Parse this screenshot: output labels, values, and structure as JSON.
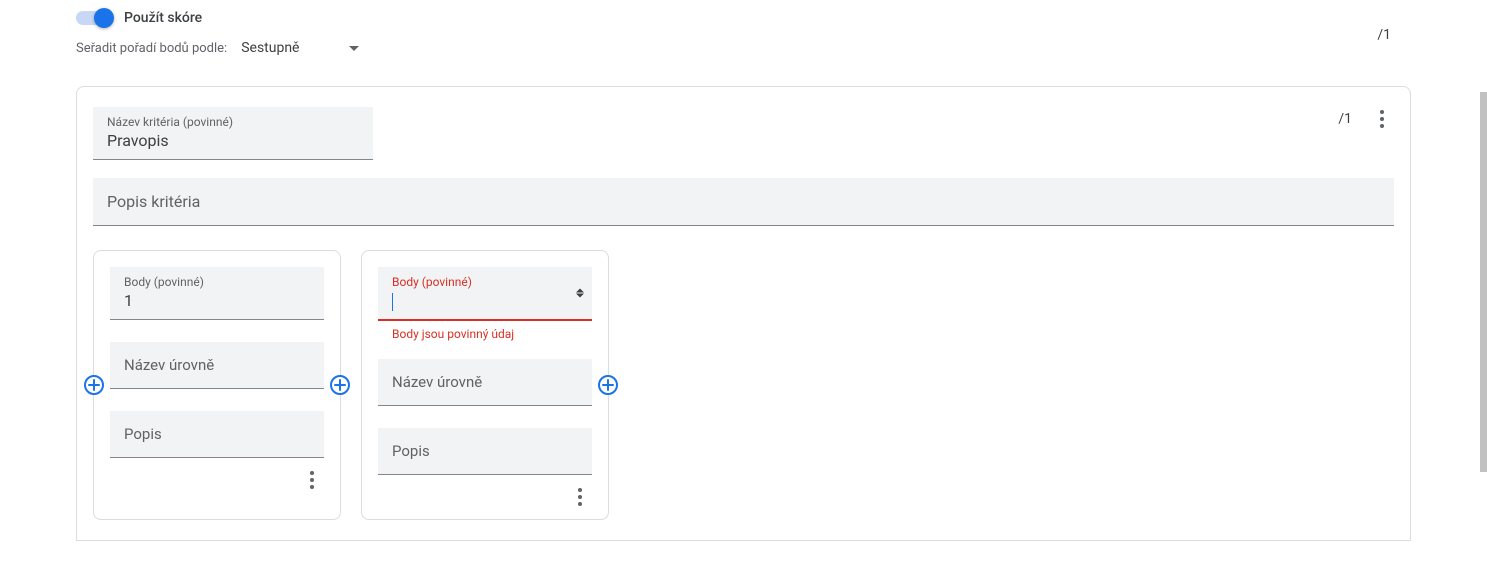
{
  "header": {
    "toggle_label": "Použít skóre",
    "sort_label": "Seřadit pořadí bodů podle:",
    "sort_value": "Sestupně",
    "total_score": "/1"
  },
  "criterion": {
    "title_label": "Název kritéria (povinné)",
    "title_value": "Pravopis",
    "desc_placeholder": "Popis kritéria",
    "score": "/1",
    "levels": [
      {
        "points_label": "Body (povinné)",
        "points_value": "1",
        "name_placeholder": "Název úrovně",
        "desc_placeholder": "Popis",
        "error": false
      },
      {
        "points_label": "Body (povinné)",
        "points_value": "",
        "name_placeholder": "Název úrovně",
        "desc_placeholder": "Popis",
        "error": true,
        "error_msg": "Body jsou povinný údaj"
      }
    ]
  }
}
